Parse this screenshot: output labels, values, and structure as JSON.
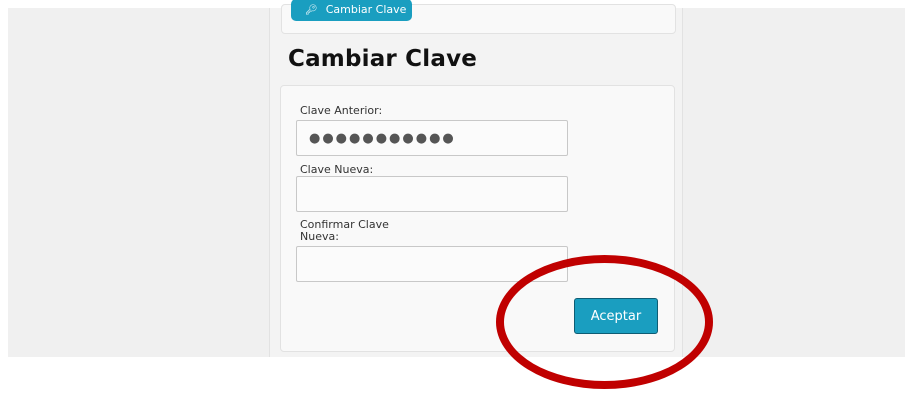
{
  "top_button": {
    "label": "Cambiar Clave",
    "icon": "key-icon"
  },
  "page_title": "Cambiar Clave",
  "form": {
    "old_password": {
      "label": "Clave Anterior:",
      "value": "●●●●●●●●●●●"
    },
    "new_password": {
      "label": "Clave Nueva:",
      "value": ""
    },
    "confirm_password": {
      "label_line1": "Confirmar Clave",
      "label_line2": "Nueva:",
      "value": ""
    },
    "submit_label": "Aceptar"
  },
  "colors": {
    "accent": "#1a9ec0",
    "highlight_ring": "#c00000"
  }
}
